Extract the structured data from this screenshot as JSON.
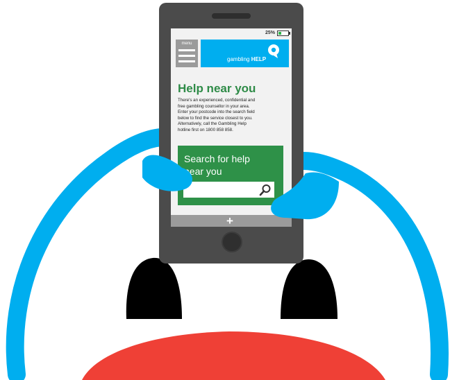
{
  "status": {
    "battery_text": "25%",
    "battery_level": 0.25,
    "battery_color": "#2fb34a"
  },
  "header": {
    "menu_label": "menu",
    "logo_word": "gambling",
    "logo_bold": "HELP",
    "logo_color": "#00aeef"
  },
  "content": {
    "title": "Help near you",
    "paragraph_lines": [
      "There's an experienced, confidential and",
      "free gambling counsellor in your area.",
      "Enter your postcode into the search field",
      "below to find the service closest to you.",
      "Alternatively, call the Gambling Help",
      "hotline first on 1800 858 858."
    ]
  },
  "search": {
    "title_line1": "Search for help",
    "title_line2": "near you",
    "input_value": "",
    "card_color": "#2e9148"
  },
  "footer": {
    "plus": "+"
  },
  "colors": {
    "arm": "#00aeef",
    "shirt": "#ef4036",
    "head": "#000000",
    "phone": "#4b4b4b"
  }
}
